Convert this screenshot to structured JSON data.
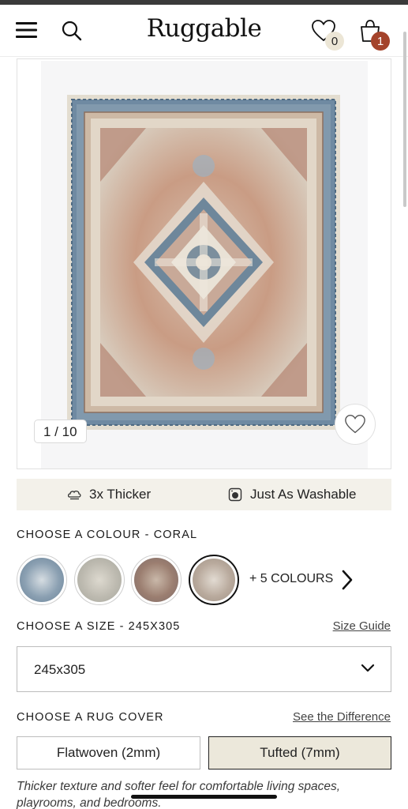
{
  "header": {
    "logo": "Ruggable",
    "wishlist_count": "0",
    "cart_count": "1"
  },
  "gallery": {
    "counter": "1 / 10"
  },
  "features": {
    "thicker": "3x Thicker",
    "washable": "Just As Washable"
  },
  "colour": {
    "label": "CHOOSE A COLOUR - CORAL",
    "more": "+ 5 COLOURS",
    "swatches": [
      {
        "name": "Blue",
        "color": "#7b93a8"
      },
      {
        "name": "Grey",
        "color": "#b9b7ad"
      },
      {
        "name": "Rust",
        "color": "#9c7e72"
      },
      {
        "name": "Coral",
        "color": "#b8ab9f",
        "selected": true
      }
    ]
  },
  "size": {
    "label": "CHOOSE A SIZE - 245X305",
    "guide_link": "Size Guide",
    "selected": "245x305"
  },
  "cover": {
    "label": "CHOOSE A RUG COVER",
    "difference_link": "See the Difference",
    "options": [
      "Flatwoven (2mm)",
      "Tufted (7mm)"
    ],
    "selected": "Tufted (7mm)",
    "description": "Thicker texture and softer feel for comfortable living spaces, playrooms, and bedrooms."
  },
  "colors": {
    "accent_badge": "#a4432b",
    "feature_bg": "#f3f1ea",
    "selected_cover_bg": "#ece8db"
  }
}
